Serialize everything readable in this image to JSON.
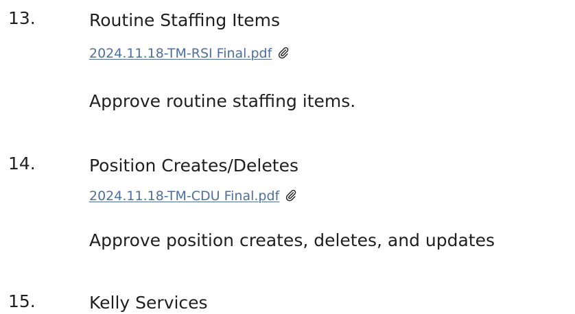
{
  "agenda": {
    "items": [
      {
        "number": "13.",
        "title": "Routine Staffing Items",
        "attachment": "2024.11.18-TM-RSI Final.pdf",
        "description": "Approve routine staffing items."
      },
      {
        "number": "14.",
        "title": "Position Creates/Deletes",
        "attachment": "2024.11.18-TM-CDU Final.pdf",
        "description": "Approve position creates, deletes, and updates"
      },
      {
        "number": "15.",
        "title": "Kelly Services"
      }
    ]
  },
  "colors": {
    "link": "#4d6fa0",
    "text": "#1f1f1f",
    "background": "#ffffff"
  }
}
